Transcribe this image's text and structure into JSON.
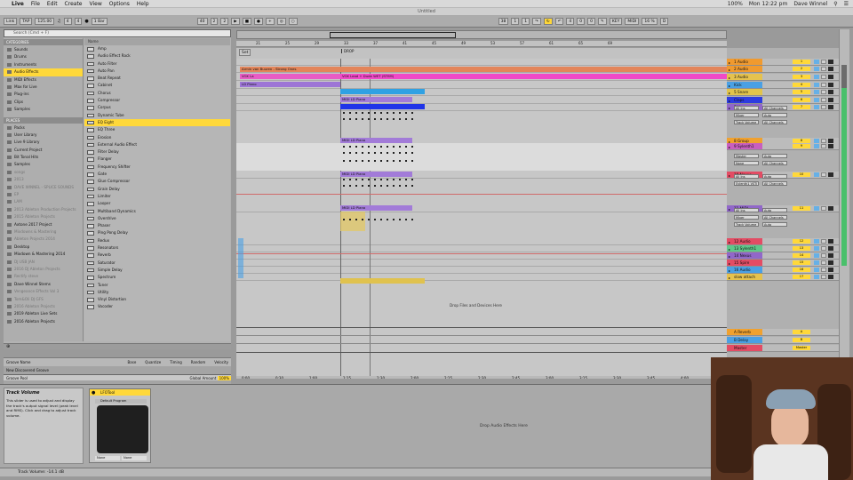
{
  "menubar": {
    "app": "Live",
    "items": [
      "File",
      "Edit",
      "Create",
      "View",
      "Options",
      "Help"
    ],
    "right": [
      "100%",
      "Mon 12:22 pm",
      "Dave Winnel"
    ]
  },
  "window_title": "Untitled",
  "transport": {
    "link": "Link",
    "tap": "TAP",
    "tempo": "125.00",
    "sig_num": "4",
    "sig_den": "4",
    "quant": "1 Bar",
    "pos_bars": "40",
    "pos_beats": "2",
    "pos_six": "2",
    "loop_start": "38",
    "loop_b": "1",
    "loop_c": "1",
    "key": "KEY",
    "midi": "MIDI",
    "cpu": "16 %",
    "d": "D"
  },
  "browser": {
    "search_placeholder": "Search (Cmd + F)",
    "categories_label": "CATEGORIES",
    "categories": [
      "Sounds",
      "Drums",
      "Instruments",
      "Audio Effects",
      "MIDI Effects",
      "Max for Live",
      "Plug-ins",
      "Clips",
      "Samples"
    ],
    "selected_category": 3,
    "places_label": "PLACES",
    "places": [
      "Packs",
      "User Library",
      "Live 9 Library",
      "Current Project",
      "Bit Tonal Hits",
      "Samples",
      "songs",
      "2013",
      "DAVE WINNEL - SPLICE SOUNDS",
      "EP",
      "LAM",
      "2013 Ableton Production Projects",
      "2015 Ableton Projects",
      "Axtone 2017 Project",
      "Mixdowns & Mastering",
      "Ableton Projects 2014",
      "Desktop",
      "Mixdown & Mastering 2014",
      "DJ USB JAN",
      "2016 DJ Ableton Projects",
      "Rectify steve",
      "Dave Winnel Stems",
      "Vengeance Effects Vol 3",
      "Tom&Oli DJ GFS",
      "2016 Ableton Projects",
      "2019 Ableton Live Sets",
      "2016 Ableton Projects"
    ],
    "places_dim": [
      6,
      7,
      8,
      9,
      10,
      11,
      12,
      14,
      15,
      18,
      19,
      20,
      22,
      23,
      24
    ],
    "list_header": "Name",
    "items": [
      "Amp",
      "Audio Effect Rack",
      "Auto Filter",
      "Auto Pan",
      "Beat Repeat",
      "Cabinet",
      "Chorus",
      "Compressor",
      "Corpus",
      "Dynamic Tube",
      "EQ Eight",
      "EQ Three",
      "Erosion",
      "External Audio Effect",
      "Filter Delay",
      "Flanger",
      "Frequency Shifter",
      "Gate",
      "Glue Compressor",
      "Grain Delay",
      "Limiter",
      "Looper",
      "Multiband Dynamics",
      "Overdrive",
      "Phaser",
      "Ping Pong Delay",
      "Redux",
      "Resonators",
      "Reverb",
      "Saturator",
      "Simple Delay",
      "Spectrum",
      "Tuner",
      "Utility",
      "Vinyl Distortion",
      "Vocoder"
    ],
    "selected_item": 10
  },
  "groove": {
    "cols": [
      "Groove Name",
      "Base",
      "Quantize",
      "Timing",
      "Random",
      "Velocity"
    ],
    "row": "New Discovered Groove",
    "pool": "Groove Pool",
    "global_label": "Global Amount",
    "global_value": "100%"
  },
  "ruler": {
    "bars": [
      "21",
      "25",
      "29",
      "33",
      "37",
      "41",
      "45",
      "49",
      "53",
      "57",
      "61",
      "65",
      "69"
    ]
  },
  "time_ruler": [
    "0:00",
    "0:30",
    "1:00",
    "1:15",
    "1:30",
    "2:00",
    "2:15",
    "2:30",
    "2:45",
    "3:00",
    "3:15",
    "3:30",
    "3:45",
    "4:00"
  ],
  "locators": {
    "set": "Set",
    "drop": "DROP"
  },
  "clips": {
    "a": "Armin van Buuren - Strong Ones",
    "b": "VOX La",
    "c": "VOX Lead + Dude WET (STEM)",
    "d": "LD Piano",
    "e": "MIDI LD Piano"
  },
  "arr_drop": "Drop Files and Devices Here",
  "tracks": [
    {
      "name": "1 Audio",
      "num": "1",
      "color": "#f09a2f"
    },
    {
      "name": "2 Audio",
      "num": "2",
      "color": "#f09a2f"
    },
    {
      "name": "3 Audio",
      "num": "3",
      "color": "#e5c24e"
    },
    {
      "name": "Kick",
      "num": "4",
      "color": "#4aa0e4"
    },
    {
      "name": "5 Snare",
      "num": "5",
      "color": "#e1c44b"
    },
    {
      "name": "Claps",
      "num": "6",
      "color": "#2d3be0"
    },
    {
      "name": "7 Harmony",
      "num": "7",
      "color": "#9167c9"
    },
    {
      "name": "8 Group",
      "num": "8",
      "color": "#f0a12f"
    },
    {
      "name": "9 Sylenth1",
      "num": "9",
      "color": "#c85fbf"
    },
    {
      "name": "10 Nexus",
      "num": "10",
      "color": "#e34c64"
    },
    {
      "name": "11 MIDI",
      "num": "11",
      "color": "#9167c9"
    },
    {
      "name": "12 Audio",
      "num": "12",
      "color": "#e34c64"
    },
    {
      "name": "13 Sylenth1",
      "num": "13",
      "color": "#5fc88a"
    },
    {
      "name": "14 Nexus",
      "num": "14",
      "color": "#9167c9"
    },
    {
      "name": "15 Spire",
      "num": "15",
      "color": "#e34c64"
    },
    {
      "name": "16 Audio",
      "num": "16",
      "color": "#4aa0e4"
    },
    {
      "name": "slow attach",
      "num": "17",
      "color": "#e5c24e"
    }
  ],
  "io": {
    "all_ins": "All Ins",
    "all_channels": "All Channels",
    "mixer": "Mixer",
    "track_volume": "Track Volume",
    "master": "Master",
    "none": "None",
    "auto": "Auto",
    "in": "In",
    "off": "Off",
    "group": "Group",
    "sylenth": "Sylenth1 VSTi"
  },
  "returns": [
    {
      "name": "A Reverb",
      "color": "#f0a12f",
      "label": "A"
    },
    {
      "name": "B Delay",
      "color": "#4aa0e4",
      "label": "B"
    },
    {
      "name": "Master",
      "color": "#e34c64",
      "label": "Master"
    }
  ],
  "info": {
    "title": "Track Volume",
    "body": "This slider is used to adjust and display the track's output signal level (peak level and RMS). Click and drag to adjust track volume."
  },
  "device": {
    "name": "LFOTool",
    "preset": "Default Program",
    "l1": "None",
    "l2": "None"
  },
  "drop_fx": "Drop Audio Effects Here",
  "status": "Track Volume: -14.1 dB"
}
